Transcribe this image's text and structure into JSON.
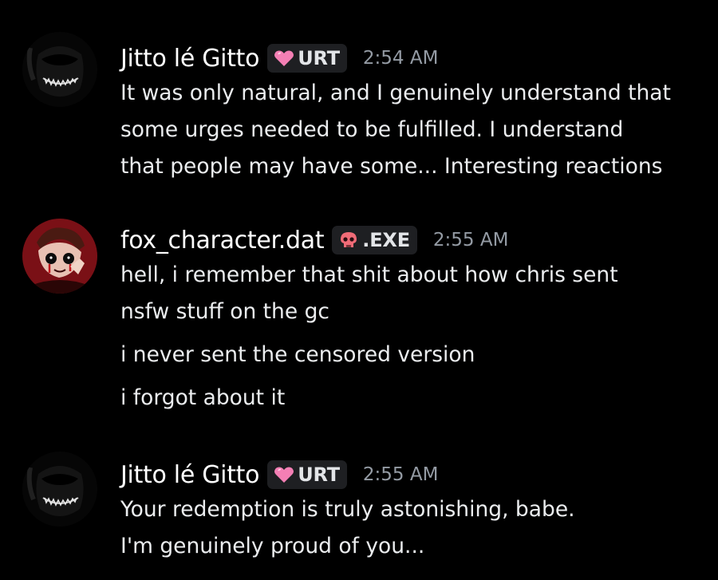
{
  "messages": [
    {
      "username": "Jitto lé Gitto",
      "tag": {
        "icon": "pink-heart-icon",
        "text": "URT",
        "color": "#f47fb4"
      },
      "timestamp": "2:54 AM",
      "lines": [
        "It was only natural, and I genuinely understand that",
        "some urges needed to be fulfilled. I understand",
        "that people may have some... Interesting reactions"
      ]
    },
    {
      "username": "fox_character.dat",
      "tag": {
        "icon": "red-skull-icon",
        "text": ".EXE",
        "color": "#f06b77"
      },
      "timestamp": "2:55 AM",
      "lines": [
        "hell, i remember that shit about how chris sent",
        "nsfw stuff on the gc",
        "i never sent the censored version",
        "i forgot about it"
      ]
    },
    {
      "username": "Jitto lé Gitto",
      "tag": {
        "icon": "pink-heart-icon",
        "text": "URT",
        "color": "#f47fb4"
      },
      "timestamp": "2:55 AM",
      "lines": [
        "Your redemption is truly astonishing, babe.",
        "I'm genuinely proud of you..."
      ]
    }
  ],
  "colors": {
    "background": "#000000",
    "username": "#ffffff",
    "message_text": "#ebedef",
    "timestamp": "#949ba4",
    "tag_background": "#1e1f22"
  }
}
